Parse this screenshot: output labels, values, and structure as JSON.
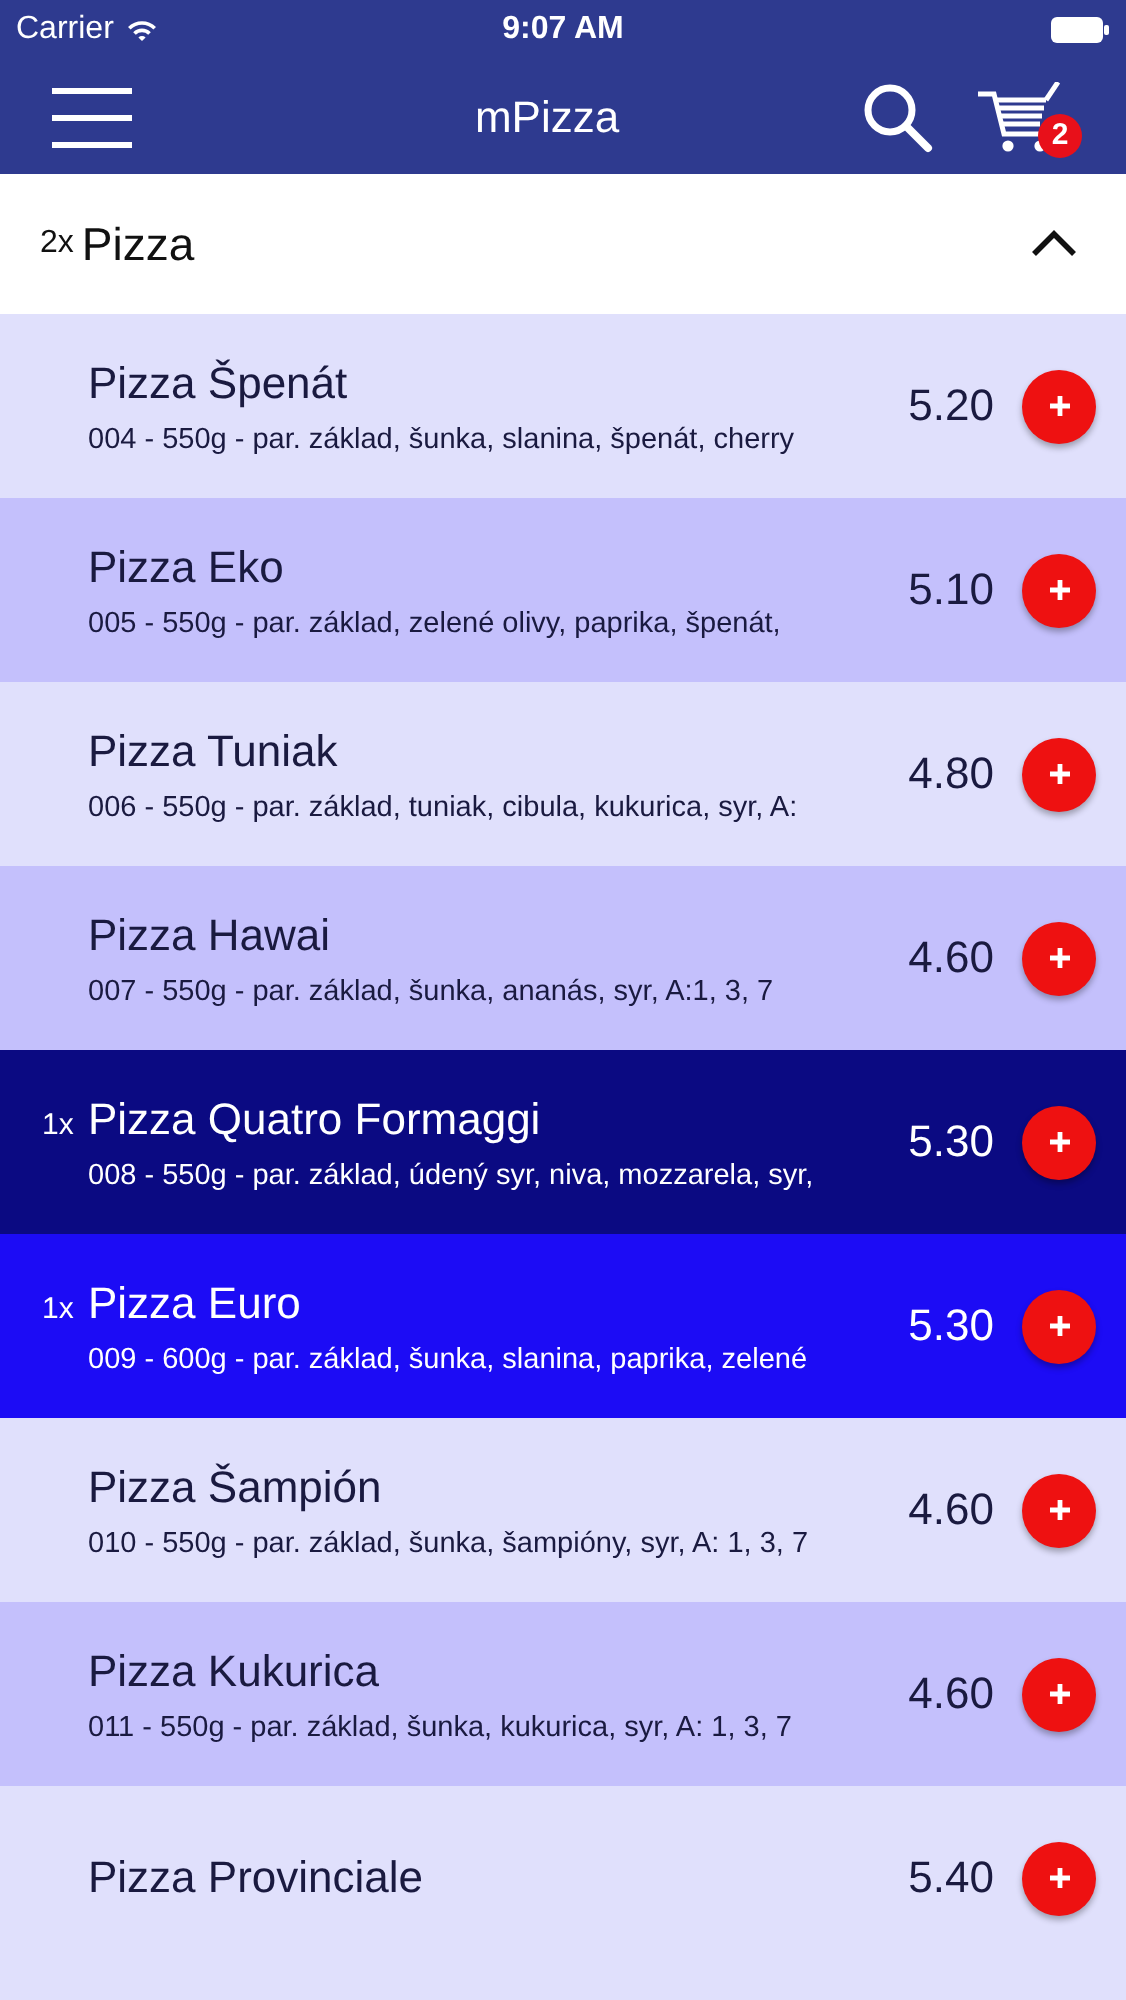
{
  "status_bar": {
    "carrier": "Carrier",
    "time": "9:07 AM"
  },
  "nav_bar": {
    "title": "mPizza",
    "cart_count": "2"
  },
  "category": {
    "count": "2x",
    "name": "Pizza",
    "expanded": true
  },
  "items": [
    {
      "name": "Pizza Špenát",
      "description": "004 - 550g - par. základ, šunka, slanina, špenát, cherry",
      "price": "5.20",
      "selected": false
    },
    {
      "name": "Pizza Eko",
      "description": "005 - 550g - par. základ, zelené olivy, paprika, špenát,",
      "price": "5.10",
      "selected": false
    },
    {
      "name": "Pizza Tuniak",
      "description": "006 - 550g - par. základ, tuniak, cibula, kukurica, syr, A:",
      "price": "4.80",
      "selected": false
    },
    {
      "name": "Pizza Hawai",
      "description": "007 - 550g - par. základ, šunka, ananás, syr, A:1, 3, 7",
      "price": "4.60",
      "selected": false
    },
    {
      "count": "1x",
      "name": "Pizza Quatro Formaggi",
      "description": "008 - 550g - par. základ, údený syr, niva, mozzarela, syr,",
      "price": "5.30",
      "selected": true
    },
    {
      "count": "1x",
      "name": "Pizza Euro",
      "description": "009 - 600g - par. základ, šunka, slanina, paprika, zelené",
      "price": "5.30",
      "selected": true
    },
    {
      "name": "Pizza Šampión",
      "description": "010 - 550g - par. základ, šunka, šampióny, syr, A: 1, 3, 7",
      "price": "4.60",
      "selected": false
    },
    {
      "name": "Pizza Kukurica",
      "description": "011 - 550g - par. základ, šunka, kukurica, syr, A: 1, 3, 7",
      "price": "4.60",
      "selected": false
    },
    {
      "name": "Pizza Provinciale",
      "price": "5.40",
      "selected": false
    }
  ]
}
